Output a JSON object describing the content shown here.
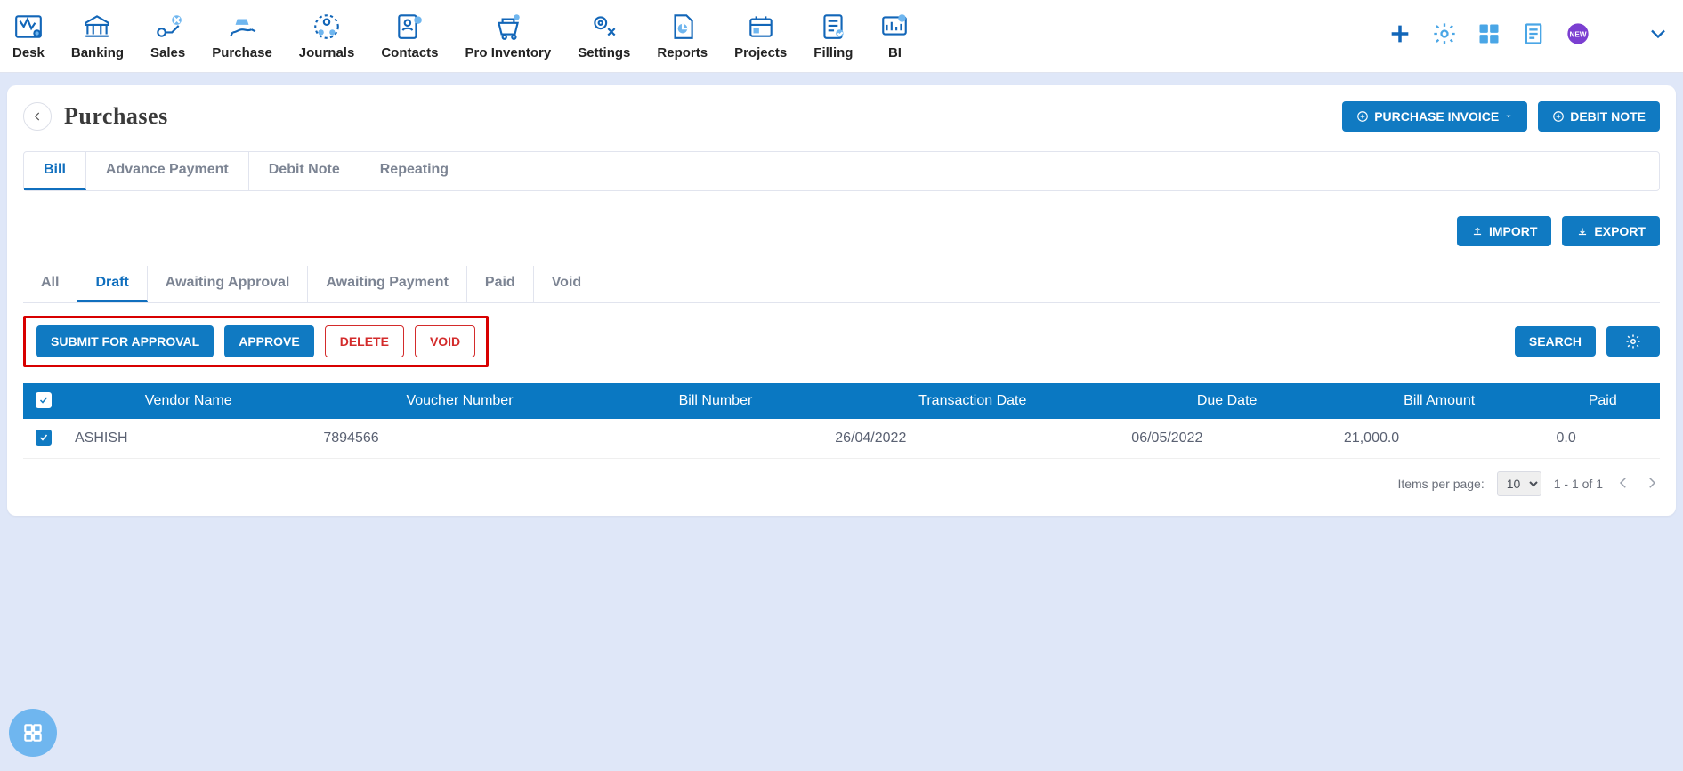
{
  "nav": {
    "items": [
      {
        "label": "Desk"
      },
      {
        "label": "Banking"
      },
      {
        "label": "Sales"
      },
      {
        "label": "Purchase"
      },
      {
        "label": "Journals"
      },
      {
        "label": "Contacts"
      },
      {
        "label": "Pro Inventory"
      },
      {
        "label": "Settings"
      },
      {
        "label": "Reports"
      },
      {
        "label": "Projects"
      },
      {
        "label": "Filling"
      },
      {
        "label": "BI"
      }
    ]
  },
  "header": {
    "title": "Purchases",
    "purchase_invoice_btn": "PURCHASE INVOICE",
    "debit_note_btn": "DEBIT NOTE"
  },
  "tabs": {
    "items": [
      {
        "label": "Bill",
        "active": true
      },
      {
        "label": "Advance Payment"
      },
      {
        "label": "Debit Note"
      },
      {
        "label": "Repeating"
      }
    ]
  },
  "import_export": {
    "import": "IMPORT",
    "export": "EXPORT"
  },
  "subtabs": {
    "items": [
      {
        "label": "All"
      },
      {
        "label": "Draft",
        "active": true
      },
      {
        "label": "Awaiting Approval"
      },
      {
        "label": "Awaiting Payment"
      },
      {
        "label": "Paid"
      },
      {
        "label": "Void"
      }
    ]
  },
  "actions": {
    "submit": "SUBMIT FOR APPROVAL",
    "approve": "APPROVE",
    "delete": "DELETE",
    "void": "VOID",
    "search": "SEARCH"
  },
  "table": {
    "headers": [
      "Vendor Name",
      "Voucher Number",
      "Bill Number",
      "Transaction Date",
      "Due Date",
      "Bill Amount",
      "Paid"
    ],
    "rows": [
      {
        "vendor": "ASHISH",
        "voucher": "7894566",
        "bill": "",
        "txn": "26/04/2022",
        "due": "06/05/2022",
        "amount": "21,000.0",
        "paid": "0.0"
      }
    ]
  },
  "pager": {
    "label": "Items per page:",
    "per_page": "10",
    "range": "1 - 1 of 1"
  }
}
